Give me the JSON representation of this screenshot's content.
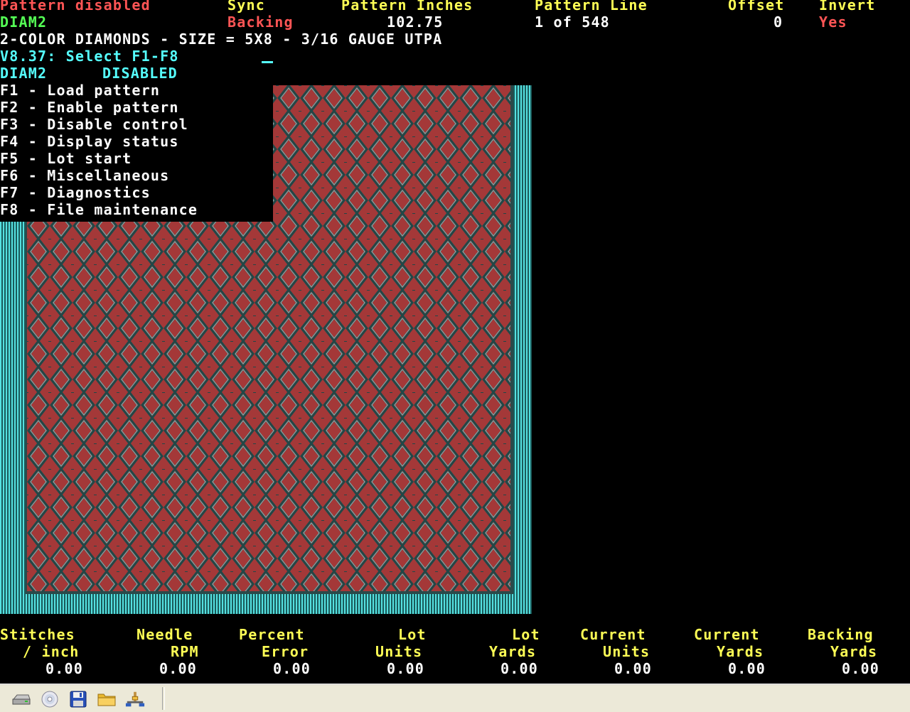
{
  "header": {
    "status_label": "Pattern disabled",
    "pattern_name": "DIAM2",
    "sync_label": "Sync",
    "sync_value": "Backing",
    "pattern_inches_label": "Pattern Inches",
    "pattern_inches_value": "102.75",
    "pattern_line_label": "Pattern Line",
    "pattern_line_value": "1 of 548",
    "offset_label": "Offset",
    "offset_value": "0",
    "invert_label": "Invert",
    "invert_value": "Yes",
    "description": "2-COLOR DIAMONDS - SIZE = 5X8 - 3/16 GAUGE UTPA",
    "prompt": "V8.37: Select F1-F8",
    "current_name": "DIAM2",
    "current_state": "DISABLED"
  },
  "menu": {
    "items": [
      {
        "key": "F1",
        "label": "F1 - Load pattern"
      },
      {
        "key": "F2",
        "label": "F2 - Enable pattern"
      },
      {
        "key": "F3",
        "label": "F3 - Disable control"
      },
      {
        "key": "F4",
        "label": "F4 - Display status"
      },
      {
        "key": "F5",
        "label": "F5 - Lot start"
      },
      {
        "key": "F6",
        "label": "F6 - Miscellaneous"
      },
      {
        "key": "F7",
        "label": "F7 - Diagnostics"
      },
      {
        "key": "F8",
        "label": "F8 - File maintenance"
      }
    ]
  },
  "stats": [
    {
      "line1": "Stitches",
      "line2": "/ inch",
      "value": "0.00"
    },
    {
      "line1": "Needle",
      "line2": "RPM",
      "value": "0.00"
    },
    {
      "line1": "Percent",
      "line2": "Error",
      "value": "0.00"
    },
    {
      "line1": "Lot",
      "line2": "Units",
      "value": "0.00"
    },
    {
      "line1": "Lot",
      "line2": "Yards",
      "value": "0.00"
    },
    {
      "line1": "Current",
      "line2": "Units",
      "value": "0.00"
    },
    {
      "line1": "Current",
      "line2": "Yards",
      "value": "0.00"
    },
    {
      "line1": "Backing",
      "line2": "Yards",
      "value": "0.00"
    }
  ],
  "taskbar": {
    "icons": [
      "drive-icon",
      "disc-icon",
      "floppy-save-icon",
      "folder-icon",
      "network-icon"
    ]
  },
  "colors": {
    "red": "#ff5555",
    "yellow": "#ffff55",
    "green": "#55ff55",
    "cyan": "#55ffff",
    "white": "#ffffff",
    "pattern_red": "#a43838",
    "pattern_teal": "#55e0e0"
  }
}
